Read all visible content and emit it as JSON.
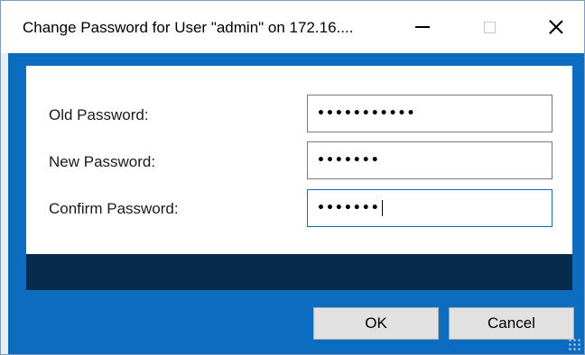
{
  "window": {
    "title": "Change Password for User \"admin\" on 172.16....",
    "controls": {
      "minimize": "minimize-icon",
      "maximize": "maximize-icon",
      "close": "close-icon"
    }
  },
  "form": {
    "fields": [
      {
        "label": "Old Password:",
        "masked_value": "•••••••••••",
        "focused": false
      },
      {
        "label": "New Password:",
        "masked_value": "•••••••",
        "focused": false
      },
      {
        "label": "Confirm Password:",
        "masked_value": "•••••••",
        "focused": true
      }
    ]
  },
  "buttons": {
    "ok_label": "OK",
    "cancel_label": "Cancel"
  },
  "colors": {
    "accent": "#0b6cc0",
    "status_strip": "#062b4c",
    "button_bg": "#e1e1e1"
  }
}
